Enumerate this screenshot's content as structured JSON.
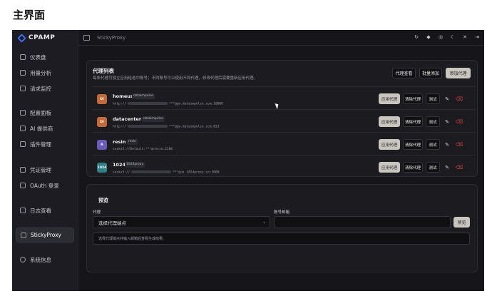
{
  "page_heading": "主界面",
  "app": {
    "brand": "CPAMP",
    "breadcrumb": "StickyProxy"
  },
  "sidebar": {
    "items": [
      {
        "label": "仪表盘",
        "icon": "dashboard-icon"
      },
      {
        "label": "用量分析",
        "icon": "chart-icon"
      },
      {
        "label": "请求监控",
        "icon": "monitor-icon"
      },
      {
        "label": "配置面板",
        "icon": "sliders-icon"
      },
      {
        "label": "AI 提供商",
        "icon": "provider-icon"
      },
      {
        "label": "插件管理",
        "icon": "plugin-icon"
      },
      {
        "label": "凭证管理",
        "icon": "credential-icon"
      },
      {
        "label": "OAuth 登录",
        "icon": "oauth-icon"
      },
      {
        "label": "日志查看",
        "icon": "log-icon"
      },
      {
        "label": "StickyProxy",
        "icon": "shield-icon",
        "active": true
      },
      {
        "label": "系统信息",
        "icon": "info-icon"
      }
    ]
  },
  "proxy_list": {
    "title": "代理列表",
    "subtitle": "每条代理可独立应用给选中账号；不同账号可以使用不同代理，修改代理后需要重新应用代理。",
    "actions": {
      "view": "代理查看",
      "batch_add": "批量添加",
      "add": "添加代理"
    },
    "row_actions": {
      "apply": "应用代理",
      "clear": "清除代理",
      "test": "测试"
    },
    "proxies": [
      {
        "avatar": "DI",
        "avatar_color": "#c46a3a",
        "name": "homeus",
        "tag": "dataimpulse",
        "url_prefix": "http://",
        "url_suffix": "***@gw.dataimpulse.com:10000"
      },
      {
        "avatar": "DI",
        "avatar_color": "#c46a3a",
        "name": "datacenter",
        "tag": "dataimpulse",
        "url_prefix": "http://",
        "url_suffix": "***@gw.dataimpulse.com:823"
      },
      {
        "avatar": "R",
        "avatar_color": "#6a5bb8",
        "name": "resin",
        "tag": "resin",
        "url_prefix": "socks5://Default:***@resin:2260",
        "url_suffix": ""
      },
      {
        "avatar": "1024",
        "avatar_color": "#2e7f86",
        "name": "1024",
        "tag": "1024proxy",
        "url_prefix": "socks5://",
        "url_suffix": "***@us.1024proxy.io:3000"
      }
    ]
  },
  "preview": {
    "title": "预览",
    "proxy_label": "代理",
    "proxy_select": "选择代理端点",
    "email_label": "账号邮箱",
    "button": "预览",
    "hint": "选择代理端点并输入邮箱后查看生成结果。"
  }
}
